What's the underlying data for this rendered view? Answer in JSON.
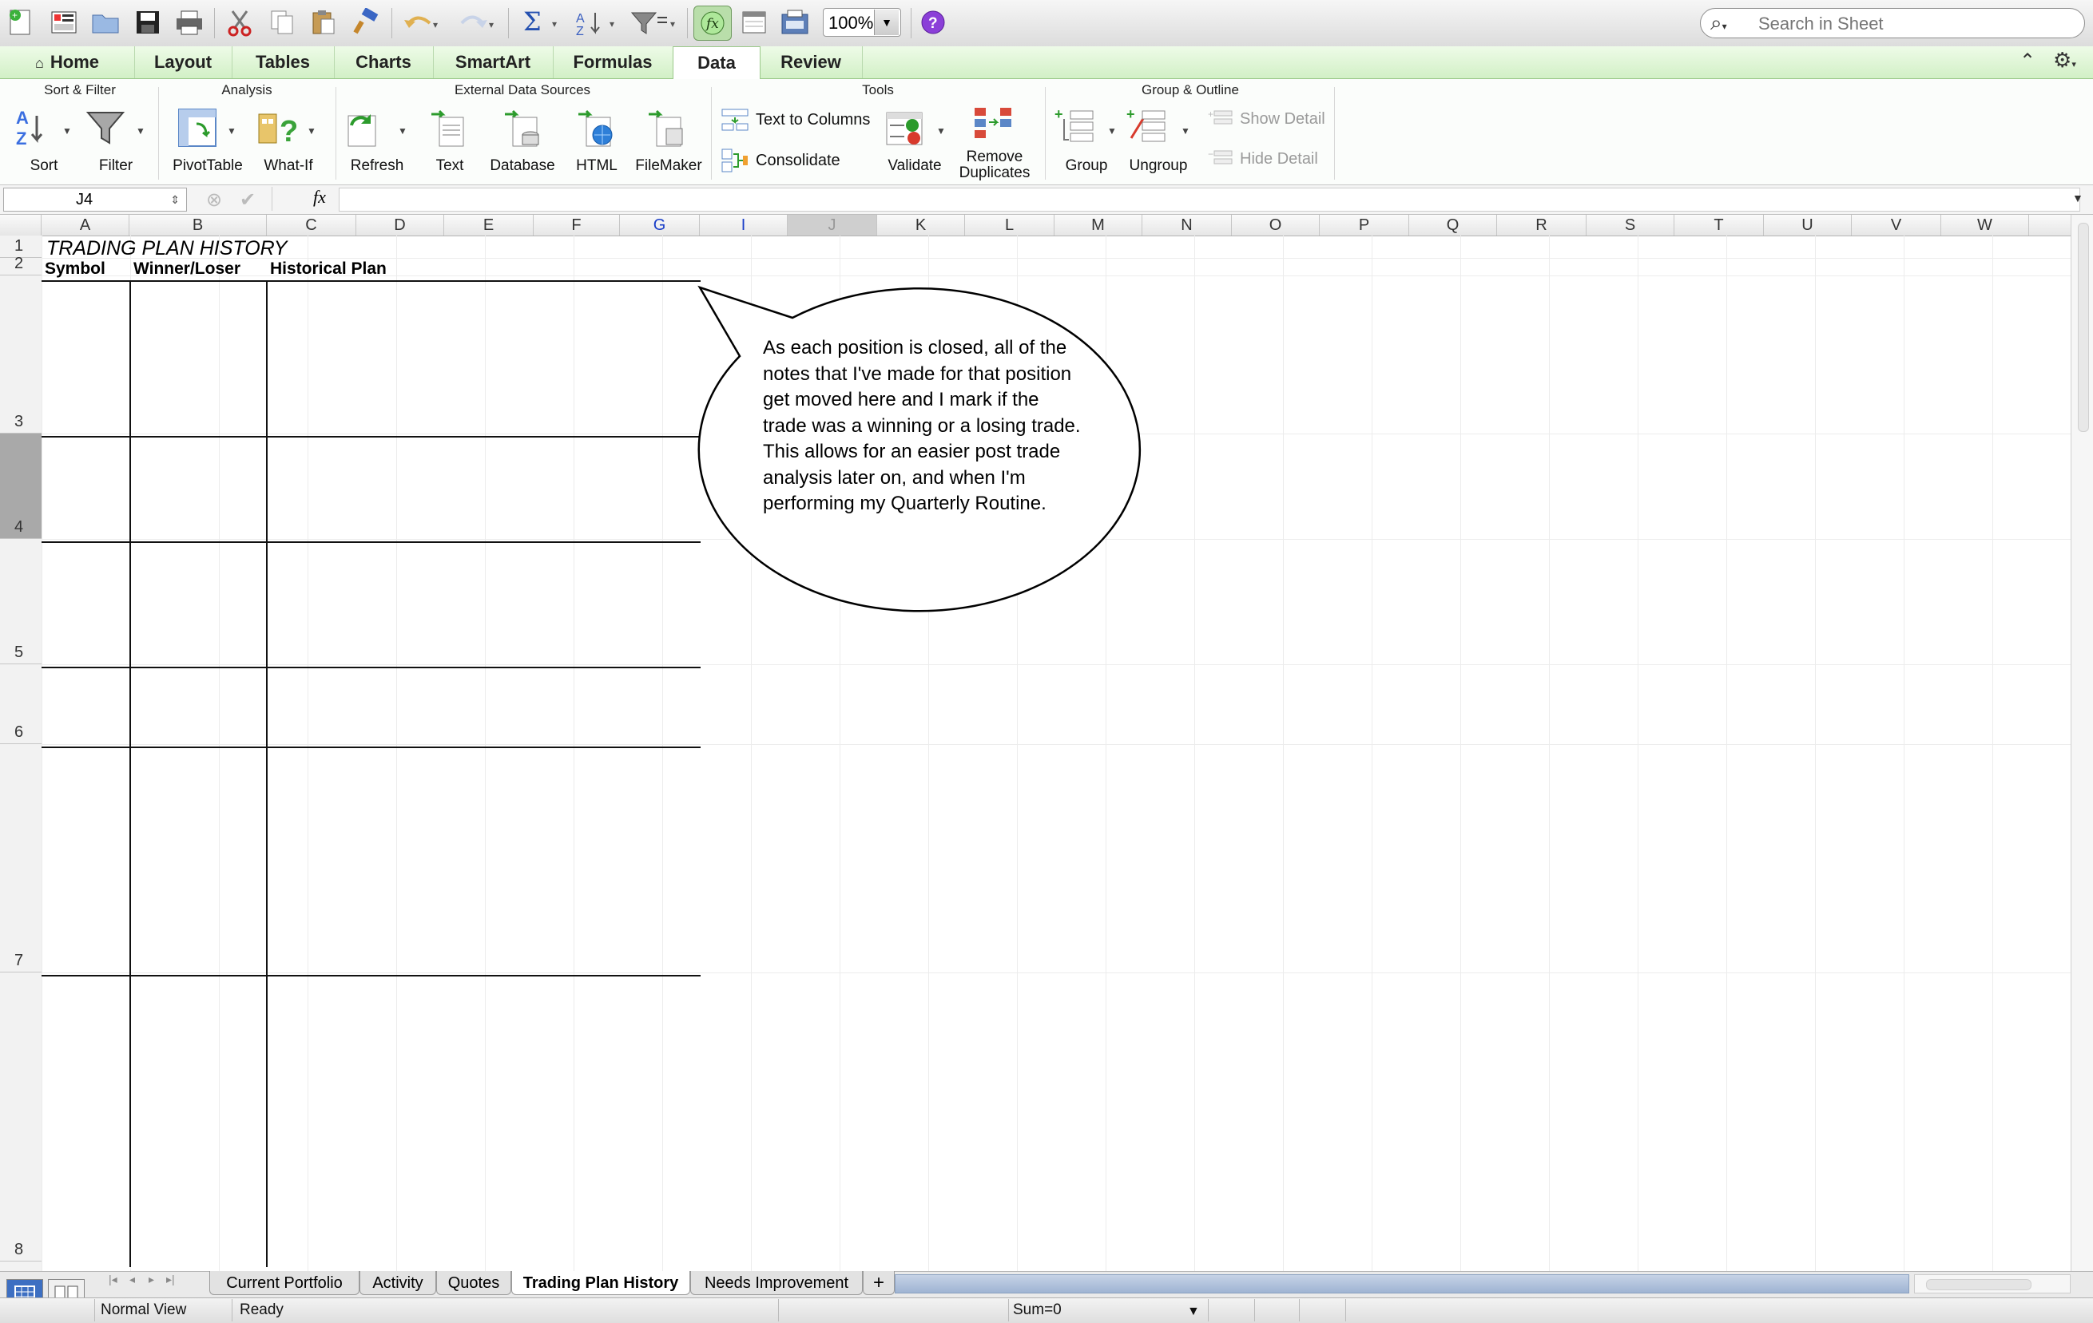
{
  "toolbar": {
    "zoom_value": "100%",
    "search_placeholder": "Search in Sheet"
  },
  "ribbon_tabs": [
    "Home",
    "Layout",
    "Tables",
    "Charts",
    "SmartArt",
    "Formulas",
    "Data",
    "Review"
  ],
  "active_tab": "Data",
  "ribbon": {
    "groups": {
      "sort_filter": "Sort & Filter",
      "analysis": "Analysis",
      "external": "External Data Sources",
      "tools": "Tools",
      "group_outline": "Group & Outline"
    },
    "sort": "Sort",
    "filter": "Filter",
    "pivottable": "PivotTable",
    "whatif": "What-If",
    "refresh": "Refresh",
    "text": "Text",
    "database": "Database",
    "html": "HTML",
    "filemaker": "FileMaker",
    "text_to_columns": "Text to Columns",
    "consolidate": "Consolidate",
    "validate": "Validate",
    "remove_dup_1": "Remove",
    "remove_dup_2": "Duplicates",
    "group": "Group",
    "ungroup": "Ungroup",
    "show_detail": "Show Detail",
    "hide_detail": "Hide Detail"
  },
  "formula_bar": {
    "cell_ref": "J4",
    "fx": "fx",
    "formula": ""
  },
  "columns": [
    "A",
    "B",
    "C",
    "D",
    "E",
    "F",
    "G",
    "I",
    "J",
    "K",
    "L",
    "M",
    "N",
    "O",
    "P",
    "Q",
    "R",
    "S",
    "T",
    "U",
    "V",
    "W"
  ],
  "rows": [
    "1",
    "2",
    "3",
    "4",
    "5",
    "6",
    "7",
    "8"
  ],
  "sheet": {
    "title": "TRADING PLAN HISTORY",
    "header_symbol": "Symbol",
    "header_winner": "Winner/Loser",
    "header_plan": "Historical Plan"
  },
  "callout": {
    "text": "As each position is closed, all of the notes that I've made for that position get moved here and I mark if the trade was a winning or a losing trade.  This allows for an easier post trade analysis later on, and when I'm performing my Quarterly Routine."
  },
  "sheet_tabs": [
    "Current Portfolio",
    "Activity",
    "Quotes",
    "Trading Plan History",
    "Needs Improvement"
  ],
  "active_sheet": "Trading Plan History",
  "status": {
    "view": "Normal View",
    "state": "Ready",
    "sum": "Sum=0"
  },
  "colors": {
    "ribbon_green": "#d2f0c6",
    "selected_col": "#1a3ec8",
    "sheet_scroll": "#9fb4d3"
  }
}
